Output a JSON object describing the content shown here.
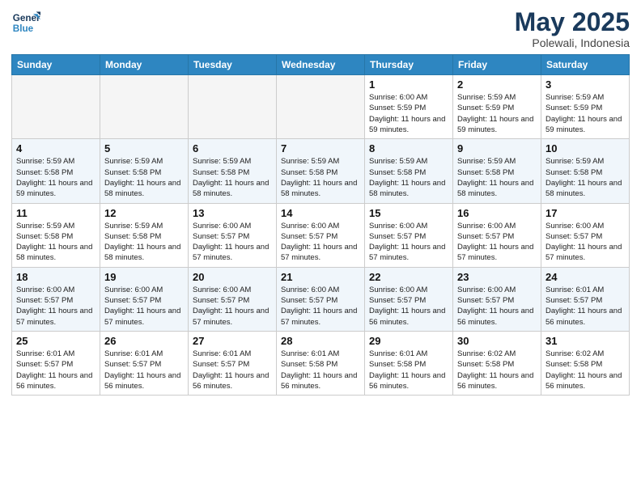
{
  "logo": {
    "line1": "General",
    "line2": "Blue"
  },
  "title": "May 2025",
  "location": "Polewali, Indonesia",
  "weekdays": [
    "Sunday",
    "Monday",
    "Tuesday",
    "Wednesday",
    "Thursday",
    "Friday",
    "Saturday"
  ],
  "weeks": [
    [
      {
        "day": "",
        "sunrise": "",
        "sunset": "",
        "daylight": ""
      },
      {
        "day": "",
        "sunrise": "",
        "sunset": "",
        "daylight": ""
      },
      {
        "day": "",
        "sunrise": "",
        "sunset": "",
        "daylight": ""
      },
      {
        "day": "",
        "sunrise": "",
        "sunset": "",
        "daylight": ""
      },
      {
        "day": "1",
        "sunrise": "Sunrise: 6:00 AM",
        "sunset": "Sunset: 5:59 PM",
        "daylight": "Daylight: 11 hours and 59 minutes."
      },
      {
        "day": "2",
        "sunrise": "Sunrise: 5:59 AM",
        "sunset": "Sunset: 5:59 PM",
        "daylight": "Daylight: 11 hours and 59 minutes."
      },
      {
        "day": "3",
        "sunrise": "Sunrise: 5:59 AM",
        "sunset": "Sunset: 5:59 PM",
        "daylight": "Daylight: 11 hours and 59 minutes."
      }
    ],
    [
      {
        "day": "4",
        "sunrise": "Sunrise: 5:59 AM",
        "sunset": "Sunset: 5:58 PM",
        "daylight": "Daylight: 11 hours and 59 minutes."
      },
      {
        "day": "5",
        "sunrise": "Sunrise: 5:59 AM",
        "sunset": "Sunset: 5:58 PM",
        "daylight": "Daylight: 11 hours and 58 minutes."
      },
      {
        "day": "6",
        "sunrise": "Sunrise: 5:59 AM",
        "sunset": "Sunset: 5:58 PM",
        "daylight": "Daylight: 11 hours and 58 minutes."
      },
      {
        "day": "7",
        "sunrise": "Sunrise: 5:59 AM",
        "sunset": "Sunset: 5:58 PM",
        "daylight": "Daylight: 11 hours and 58 minutes."
      },
      {
        "day": "8",
        "sunrise": "Sunrise: 5:59 AM",
        "sunset": "Sunset: 5:58 PM",
        "daylight": "Daylight: 11 hours and 58 minutes."
      },
      {
        "day": "9",
        "sunrise": "Sunrise: 5:59 AM",
        "sunset": "Sunset: 5:58 PM",
        "daylight": "Daylight: 11 hours and 58 minutes."
      },
      {
        "day": "10",
        "sunrise": "Sunrise: 5:59 AM",
        "sunset": "Sunset: 5:58 PM",
        "daylight": "Daylight: 11 hours and 58 minutes."
      }
    ],
    [
      {
        "day": "11",
        "sunrise": "Sunrise: 5:59 AM",
        "sunset": "Sunset: 5:58 PM",
        "daylight": "Daylight: 11 hours and 58 minutes."
      },
      {
        "day": "12",
        "sunrise": "Sunrise: 5:59 AM",
        "sunset": "Sunset: 5:58 PM",
        "daylight": "Daylight: 11 hours and 58 minutes."
      },
      {
        "day": "13",
        "sunrise": "Sunrise: 6:00 AM",
        "sunset": "Sunset: 5:57 PM",
        "daylight": "Daylight: 11 hours and 57 minutes."
      },
      {
        "day": "14",
        "sunrise": "Sunrise: 6:00 AM",
        "sunset": "Sunset: 5:57 PM",
        "daylight": "Daylight: 11 hours and 57 minutes."
      },
      {
        "day": "15",
        "sunrise": "Sunrise: 6:00 AM",
        "sunset": "Sunset: 5:57 PM",
        "daylight": "Daylight: 11 hours and 57 minutes."
      },
      {
        "day": "16",
        "sunrise": "Sunrise: 6:00 AM",
        "sunset": "Sunset: 5:57 PM",
        "daylight": "Daylight: 11 hours and 57 minutes."
      },
      {
        "day": "17",
        "sunrise": "Sunrise: 6:00 AM",
        "sunset": "Sunset: 5:57 PM",
        "daylight": "Daylight: 11 hours and 57 minutes."
      }
    ],
    [
      {
        "day": "18",
        "sunrise": "Sunrise: 6:00 AM",
        "sunset": "Sunset: 5:57 PM",
        "daylight": "Daylight: 11 hours and 57 minutes."
      },
      {
        "day": "19",
        "sunrise": "Sunrise: 6:00 AM",
        "sunset": "Sunset: 5:57 PM",
        "daylight": "Daylight: 11 hours and 57 minutes."
      },
      {
        "day": "20",
        "sunrise": "Sunrise: 6:00 AM",
        "sunset": "Sunset: 5:57 PM",
        "daylight": "Daylight: 11 hours and 57 minutes."
      },
      {
        "day": "21",
        "sunrise": "Sunrise: 6:00 AM",
        "sunset": "Sunset: 5:57 PM",
        "daylight": "Daylight: 11 hours and 57 minutes."
      },
      {
        "day": "22",
        "sunrise": "Sunrise: 6:00 AM",
        "sunset": "Sunset: 5:57 PM",
        "daylight": "Daylight: 11 hours and 56 minutes."
      },
      {
        "day": "23",
        "sunrise": "Sunrise: 6:00 AM",
        "sunset": "Sunset: 5:57 PM",
        "daylight": "Daylight: 11 hours and 56 minutes."
      },
      {
        "day": "24",
        "sunrise": "Sunrise: 6:01 AM",
        "sunset": "Sunset: 5:57 PM",
        "daylight": "Daylight: 11 hours and 56 minutes."
      }
    ],
    [
      {
        "day": "25",
        "sunrise": "Sunrise: 6:01 AM",
        "sunset": "Sunset: 5:57 PM",
        "daylight": "Daylight: 11 hours and 56 minutes."
      },
      {
        "day": "26",
        "sunrise": "Sunrise: 6:01 AM",
        "sunset": "Sunset: 5:57 PM",
        "daylight": "Daylight: 11 hours and 56 minutes."
      },
      {
        "day": "27",
        "sunrise": "Sunrise: 6:01 AM",
        "sunset": "Sunset: 5:57 PM",
        "daylight": "Daylight: 11 hours and 56 minutes."
      },
      {
        "day": "28",
        "sunrise": "Sunrise: 6:01 AM",
        "sunset": "Sunset: 5:58 PM",
        "daylight": "Daylight: 11 hours and 56 minutes."
      },
      {
        "day": "29",
        "sunrise": "Sunrise: 6:01 AM",
        "sunset": "Sunset: 5:58 PM",
        "daylight": "Daylight: 11 hours and 56 minutes."
      },
      {
        "day": "30",
        "sunrise": "Sunrise: 6:02 AM",
        "sunset": "Sunset: 5:58 PM",
        "daylight": "Daylight: 11 hours and 56 minutes."
      },
      {
        "day": "31",
        "sunrise": "Sunrise: 6:02 AM",
        "sunset": "Sunset: 5:58 PM",
        "daylight": "Daylight: 11 hours and 56 minutes."
      }
    ]
  ]
}
